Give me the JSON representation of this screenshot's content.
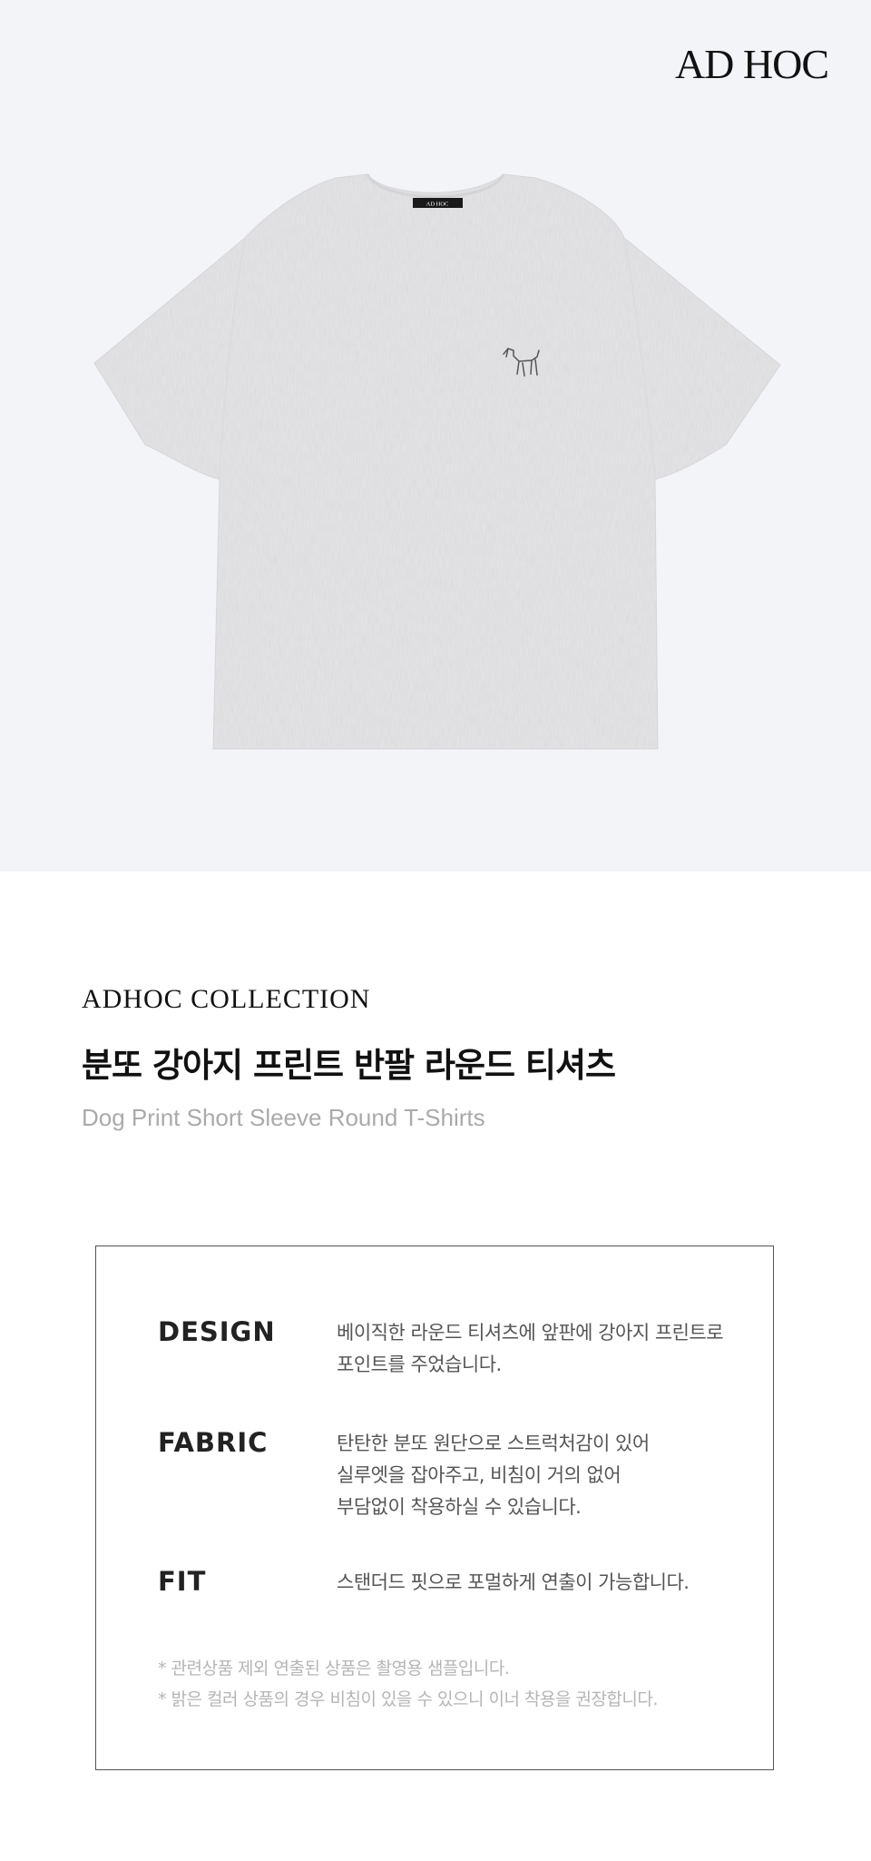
{
  "hero": {
    "brand": "AD HOC",
    "tshirt_tag_text": "AD HOC",
    "tshirt_color": "#e6e6e8",
    "background_color": "#f3f4f8"
  },
  "product": {
    "collection": "ADHOC COLLECTION",
    "title_ko": "분또 강아지 프린트 반팔 라운드 티셔츠",
    "title_en": "Dog Print Short Sleeve Round T-Shirts"
  },
  "specs": {
    "design": {
      "label": "DESIGN",
      "lines": [
        "베이직한 라운드 티셔츠에 앞판에 강아지 프린트로",
        "포인트를 주었습니다."
      ]
    },
    "fabric": {
      "label": "FABRIC",
      "lines": [
        "탄탄한 분또 원단으로 스트럭처감이 있어",
        "실루엣을 잡아주고, 비침이 거의 없어",
        "부담없이 착용하실 수 있습니다."
      ]
    },
    "fit": {
      "label": "FIT",
      "lines": [
        "스탠더드 핏으로 포멀하게 연출이 가능합니다."
      ]
    }
  },
  "notes": [
    "* 관련상품 제외 연출된 상품은 촬영용 샘플입니다.",
    "* 밝은 컬러 상품의 경우 비침이 있을 수 있으니 이너 착용을 권장합니다."
  ]
}
